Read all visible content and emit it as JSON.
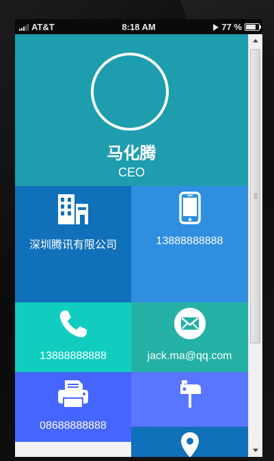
{
  "status_bar": {
    "carrier": "AT&T",
    "time": "8:18 AM",
    "battery": "77 %",
    "battery_level": 0.77
  },
  "profile": {
    "name": "马化腾",
    "title": "CEO"
  },
  "tiles": {
    "company": {
      "icon": "building-icon",
      "label": "深圳腾讯有限公司",
      "color": "#1170ba"
    },
    "mobile": {
      "icon": "mobile-phone-icon",
      "label": "13888888888",
      "color": "#2f8ee0"
    },
    "telephone": {
      "icon": "phone-handset-icon",
      "label": "13888888888",
      "color": "#10cdbf"
    },
    "email": {
      "icon": "envelope-icon",
      "label": "jack.ma@qq.com",
      "color": "#24b0a4"
    },
    "fax": {
      "icon": "fax-icon",
      "label": "08688888888",
      "color": "#4466ff"
    },
    "mailbox": {
      "icon": "mailbox-icon",
      "color": "#5876ff"
    },
    "location": {
      "icon": "location-pin-icon",
      "color": "#1170ba"
    }
  },
  "colors": {
    "header": "#1e9dae"
  }
}
